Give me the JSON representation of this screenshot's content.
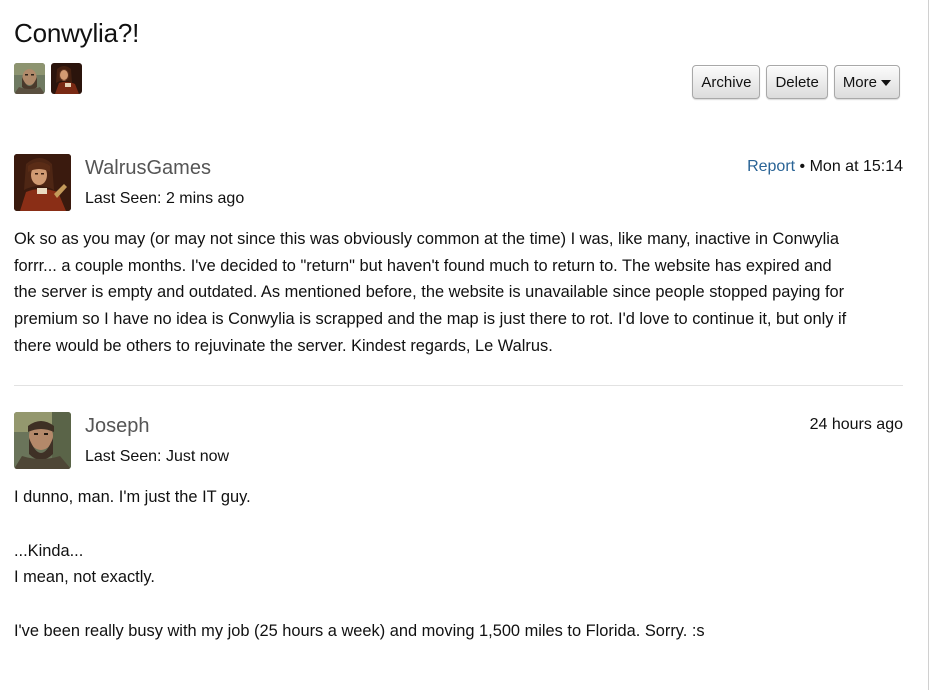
{
  "thread": {
    "title": "Conwylia?!"
  },
  "participants": [
    {
      "name": "Joseph",
      "avatar": "bearded-man-avatar"
    },
    {
      "name": "WalrusGames",
      "avatar": "portrait-painting-avatar"
    }
  ],
  "actions": {
    "archive": "Archive",
    "delete": "Delete",
    "more": "More"
  },
  "posts": [
    {
      "author": "WalrusGames",
      "last_seen": "Last Seen: 2 mins ago",
      "report": "Report",
      "separator": " • ",
      "time": "Mon at 15:14",
      "lines": [
        "Ok so as you may (or may not since this was obviously common at the time) I was, like many, inactive in Conwylia",
        "forrr... a couple months. I've decided to \"return\" but haven't found much to return to. The website has expired and",
        "the server is empty and outdated. As mentioned before, the website is unavailable since people stopped paying for",
        "premium so I have no idea is Conwylia is scrapped and the map is just there to rot. I'd love to continue it, but only if",
        "there would be others to rejuvinate the server. Kindest regards, Le Walrus."
      ]
    },
    {
      "author": "Joseph",
      "last_seen": "Last Seen: Just now",
      "time": "24 hours ago",
      "lines": [
        "I dunno, man. I'm just the IT guy.",
        "",
        "...Kinda...",
        "I mean, not exactly.",
        "",
        "I've been really busy with my job (25 hours a week) and moving 1,500 miles to Florida. Sorry. :s"
      ]
    }
  ],
  "colors": {
    "link": "#2a6496",
    "author": "#555555",
    "divider": "#e2e2e2"
  }
}
